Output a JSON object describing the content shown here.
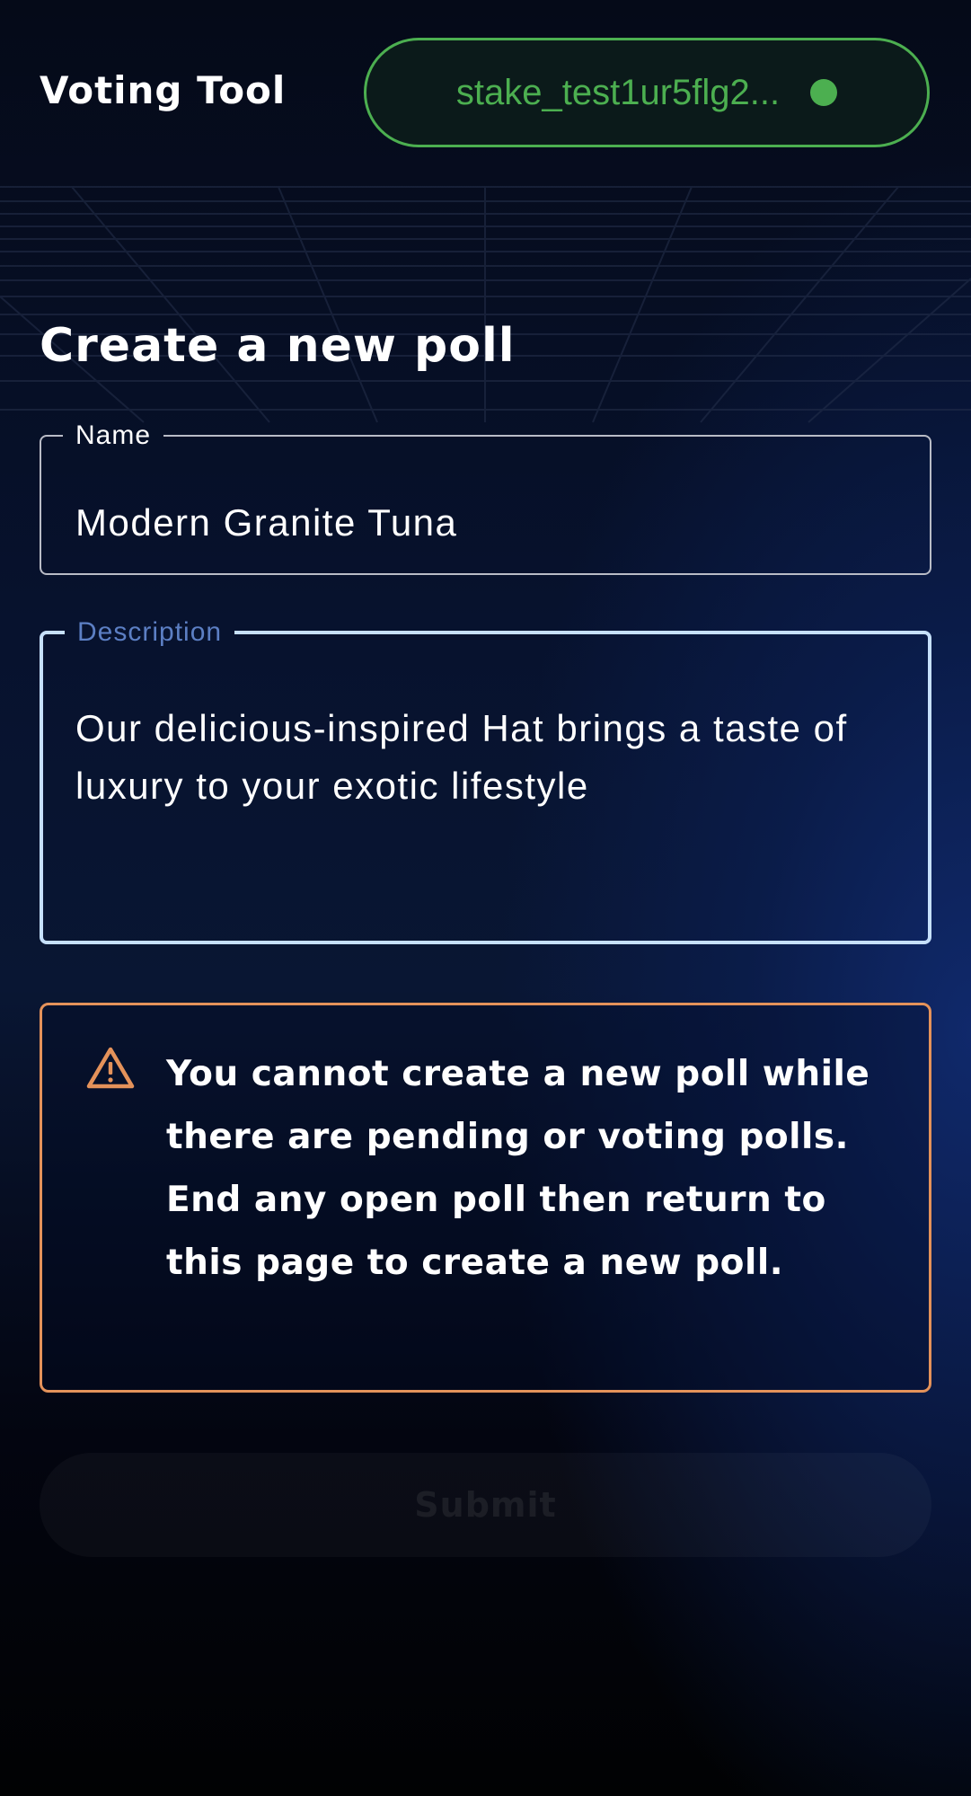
{
  "header": {
    "app_title": "Voting Tool",
    "wallet": {
      "address": "stake_test1ur5flg2...",
      "status": "connected",
      "status_icon": "status-dot-icon",
      "accent_color": "#4caf50"
    }
  },
  "main": {
    "page_title": "Create a new poll",
    "name_field": {
      "label": "Name",
      "value": "Modern Granite Tuna"
    },
    "description_field": {
      "label": "Description",
      "value": "Our delicious-inspired Hat brings a taste of luxury to your exotic lifestyle",
      "state": "focused"
    },
    "alert": {
      "severity": "warning",
      "icon": "warning-icon",
      "color": "#e4925a",
      "message": "You cannot create a new poll while there are pending or voting polls. End any open poll then return to this page to create a new poll."
    },
    "submit": {
      "label": "Submit",
      "disabled": true
    }
  },
  "theme": {
    "background_dark": "#050a18",
    "background_accent": "#102a6e",
    "focus_border": "#c6e0fb",
    "focus_label": "#5c7fc4"
  }
}
